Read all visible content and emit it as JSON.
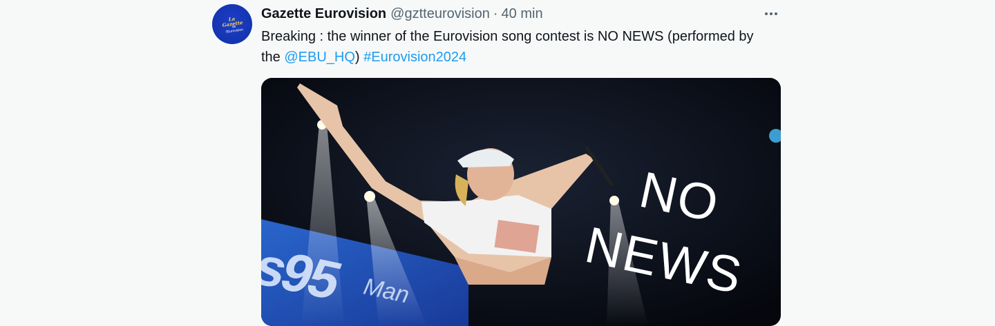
{
  "tweet": {
    "display_name": "Gazette Eurovision",
    "handle": "@gztteurovision",
    "separator": "·",
    "time": "40 min",
    "avatar_text": "La Gazette",
    "avatar_sub": "de l'Eurovision",
    "text_part1": "Breaking : the winner of the Eurovision song contest is NO NEWS (performed by the ",
    "mention": "@EBU_HQ",
    "text_part2": ") ",
    "hashtag": "#Eurovision2024",
    "more_icon": "more-horizontal-icon",
    "media": {
      "overlay_line1": "NO",
      "overlay_line2": "NEWS",
      "screen_text": "s95",
      "screen_sub": "Man"
    }
  },
  "colors": {
    "background": "#f7f9f9",
    "text": "#0f1419",
    "secondary": "#536471",
    "link": "#1d9bf0",
    "avatar": "#1434b0"
  }
}
